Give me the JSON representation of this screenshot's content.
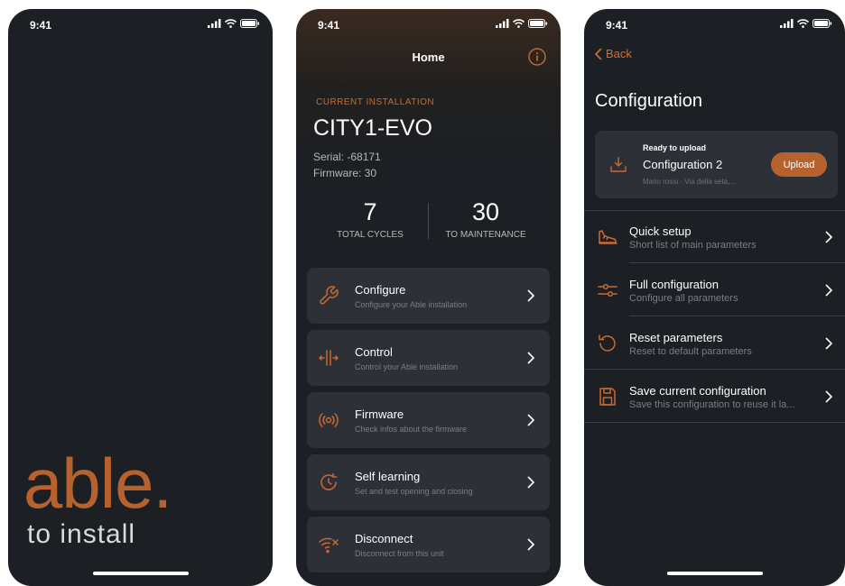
{
  "status_time": "9:41",
  "splash": {
    "brand": "able.",
    "tagline": "to install"
  },
  "home": {
    "nav_title": "Home",
    "current_label": "CURRENT INSTALLATION",
    "device_name": "CITY1-EVO",
    "serial": "Serial: -68171",
    "firmware": "Firmware: 30",
    "stats": [
      {
        "value": "7",
        "label": "TOTAL CYCLES"
      },
      {
        "value": "30",
        "label": "TO MAINTENANCE"
      }
    ],
    "menu": [
      {
        "title": "Configure",
        "subtitle": "Configure your Able installation",
        "icon": "wrench-icon"
      },
      {
        "title": "Control",
        "subtitle": "Control your Able installation",
        "icon": "gate-arrows-icon"
      },
      {
        "title": "Firmware",
        "subtitle": "Check infos about the firmware",
        "icon": "signal-icon"
      },
      {
        "title": "Self learning",
        "subtitle": "Set and test opening and closing",
        "icon": "learning-icon"
      },
      {
        "title": "Disconnect",
        "subtitle": "Disconnect from this unit",
        "icon": "wifi-off-icon"
      }
    ]
  },
  "config": {
    "back_label": "Back",
    "title": "Configuration",
    "upload_card": {
      "status": "Ready to upload",
      "name": "Configuration 2",
      "meta": "Mario rossi - Via della seta,...",
      "button": "Upload"
    },
    "items": [
      {
        "title": "Quick setup",
        "subtitle": "Short list of main parameters",
        "icon": "shoe-icon"
      },
      {
        "title": "Full configuration",
        "subtitle": "Configure all parameters",
        "icon": "sliders-icon"
      },
      {
        "title": "Reset parameters",
        "subtitle": "Reset to default parameters",
        "icon": "reset-icon"
      },
      {
        "title": "Save current configuration",
        "subtitle": "Save this configuration to reuse it la...",
        "icon": "save-icon"
      }
    ]
  },
  "colors": {
    "accent": "#c96a32",
    "background": "#1c1f24",
    "card": "#2d3036"
  }
}
